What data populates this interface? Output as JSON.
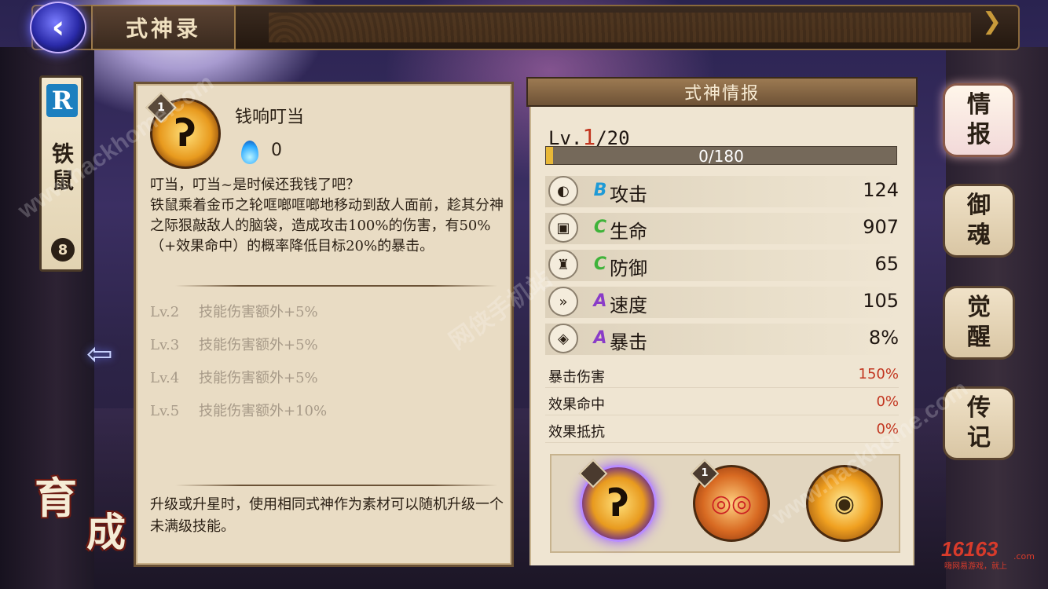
{
  "header": {
    "title": "式神录",
    "back_icon": "‹"
  },
  "shikigami": {
    "rarity": "R",
    "name": "铁鼠",
    "star": "8"
  },
  "growth_badge": {
    "char1": "育",
    "char2": "成"
  },
  "skill": {
    "num": "1",
    "name": "钱响叮当",
    "cost": "0",
    "description": "叮当，叮当~是时候还我钱了吧？\n铁鼠乘着金币之轮哐啷哐啷地移动到敌人面前，趁其分神之际狠敲敌人的脑袋，造成攻击100%的伤害，有50%（+效果命中）的概率降低目标20%的暴击。",
    "levels": [
      {
        "lv": "Lv.2",
        "text": "技能伤害额外+5%"
      },
      {
        "lv": "Lv.3",
        "text": "技能伤害额外+5%"
      },
      {
        "lv": "Lv.4",
        "text": "技能伤害额外+5%"
      },
      {
        "lv": "Lv.5",
        "text": "技能伤害额外+10%"
      }
    ],
    "footnote": "升级或升星时，使用相同式神作为素材可以随机升级一个未满级技能。"
  },
  "info": {
    "title": "式神情报",
    "lv_prefix": "Lv.",
    "lv_current": "1",
    "lv_max": "/20",
    "exp_text": "0/180",
    "exp_progress": 0.01,
    "stats": [
      {
        "icon": "fan-icon",
        "glyph": "◐",
        "grade": "B",
        "grade_color": "#1f9ad6",
        "label": "攻击",
        "value": "124"
      },
      {
        "icon": "scroll-icon",
        "glyph": "▣",
        "grade": "C",
        "grade_color": "#3fb33a",
        "label": "生命",
        "value": "907"
      },
      {
        "icon": "armor-icon",
        "glyph": "♜",
        "grade": "C",
        "grade_color": "#3fb33a",
        "label": "防御",
        "value": "65"
      },
      {
        "icon": "speed-icon",
        "glyph": "»",
        "grade": "A",
        "grade_color": "#8a3cc8",
        "label": "速度",
        "value": "105"
      },
      {
        "icon": "crit-icon",
        "glyph": "◈",
        "grade": "A",
        "grade_color": "#8a3cc8",
        "label": "暴击",
        "value": "8%"
      }
    ],
    "substats": [
      {
        "label": "暴击伤害",
        "value": "150%"
      },
      {
        "label": "效果命中",
        "value": "0%"
      },
      {
        "label": "效果抵抗",
        "value": "0%"
      }
    ],
    "skill_icons": [
      {
        "name": "skill-1-icon",
        "glyph": "ʔ",
        "badge": ""
      },
      {
        "name": "skill-2-icon",
        "glyph": "◎◎",
        "badge": "1"
      },
      {
        "name": "skill-3-icon",
        "glyph": "◉",
        "badge": ""
      }
    ]
  },
  "tabs": [
    {
      "label_top": "情",
      "label_bottom": "报"
    },
    {
      "label_top": "御",
      "label_bottom": "魂"
    },
    {
      "label_top": "觉",
      "label_bottom": "醒"
    },
    {
      "label_top": "传",
      "label_bottom": "记"
    }
  ],
  "watermarks": [
    "www.hackhome.com",
    "网侠手机站",
    "www.hackhome.com"
  ],
  "site_logo": {
    "main": "16163",
    "sub": "嗨网易游戏，就上",
    "domain": ".com"
  }
}
